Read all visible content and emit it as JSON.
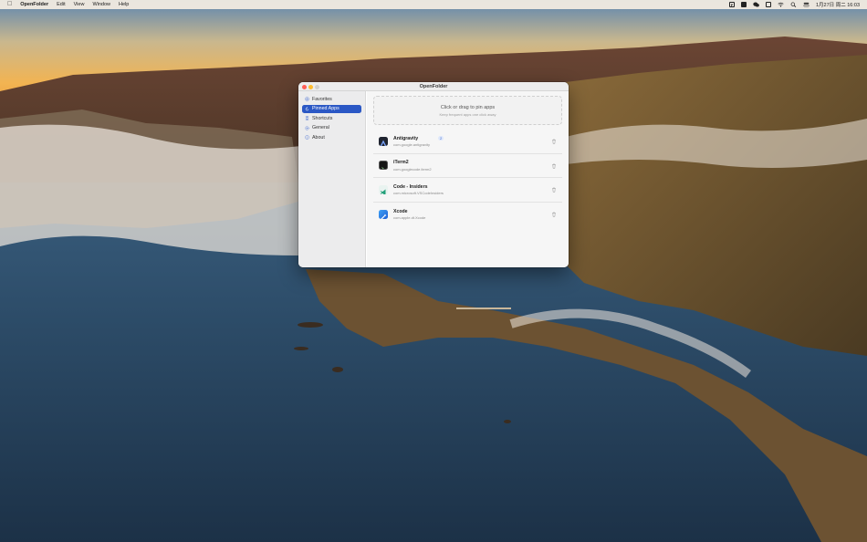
{
  "menubar": {
    "app_name": "OpenFolder",
    "menus": [
      "Edit",
      "View",
      "Window",
      "Help"
    ],
    "clock": "1月27日 周二 16:03",
    "status_icons": [
      "finder-badge-icon",
      "dark-square-icon",
      "wechat-icon",
      "keyboard-icon",
      "wifi-icon",
      "spotlight-search-icon",
      "control-center-icon"
    ]
  },
  "window": {
    "title": "OpenFolder"
  },
  "sidebar": {
    "items": [
      {
        "label": "Favorites",
        "icon": "star-icon",
        "active": false
      },
      {
        "label": "Pinned Apps",
        "icon": "pin-refresh-icon",
        "active": true
      },
      {
        "label": "Shortcuts",
        "icon": "command-icon",
        "active": false
      },
      {
        "label": "General",
        "icon": "gear-icon",
        "active": false
      },
      {
        "label": "About",
        "icon": "info-icon",
        "active": false
      }
    ]
  },
  "dropzone": {
    "title": "Click or drag to pin apps",
    "subtitle": "Keep frequent apps one click away"
  },
  "apps": [
    {
      "name": "Antigravity",
      "bundle": "com.google.antigravity",
      "badge": "2",
      "icon": "antigravity-icon"
    },
    {
      "name": "iTerm2",
      "bundle": "com.googlecode.iterm2",
      "badge": "",
      "icon": "iterm-icon"
    },
    {
      "name": "Code - Insiders",
      "bundle": "com.microsoft.VSCodeInsiders",
      "badge": "",
      "icon": "vscode-insiders-icon"
    },
    {
      "name": "Xcode",
      "bundle": "com.apple.dt.Xcode",
      "badge": "",
      "icon": "xcode-icon"
    }
  ],
  "colors": {
    "accent": "#2b58c5",
    "close": "#ff5f57",
    "minimize": "#febc2e"
  }
}
